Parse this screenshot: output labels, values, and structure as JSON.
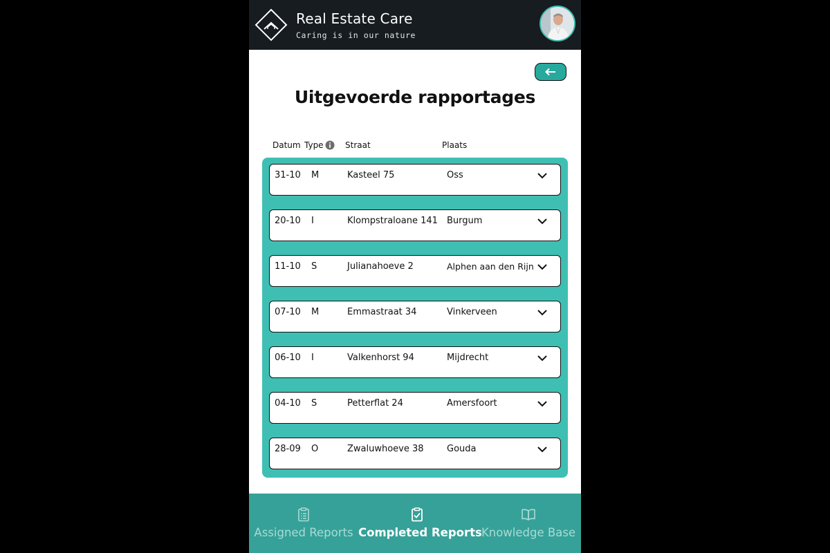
{
  "header": {
    "title": "Real Estate Care",
    "subtitle": "Caring is in our nature",
    "logo_icon": "diamond-house-icon",
    "avatar_icon": "user-avatar"
  },
  "toolbar": {
    "back_icon": "arrow-left-icon"
  },
  "page": {
    "title": "Uitgevoerde rapportages"
  },
  "table": {
    "columns": [
      "Datum",
      "Type",
      "Straat",
      "Plaats"
    ],
    "type_info_icon": "info-icon",
    "rows": [
      {
        "date": "31-10",
        "type": "M",
        "street": "Kasteel 75",
        "city": "Oss"
      },
      {
        "date": "20-10",
        "type": "I",
        "street": "Klompstraloane 141",
        "city": "Burgum"
      },
      {
        "date": "11-10",
        "type": "S",
        "street": "Julianahoeve 2",
        "city": "Alphen aan den Rijn"
      },
      {
        "date": "07-10",
        "type": "M",
        "street": "Emmastraat 34",
        "city": "Vinkerveen"
      },
      {
        "date": "06-10",
        "type": "I",
        "street": "Valkenhorst 94",
        "city": "Mijdrecht"
      },
      {
        "date": "04-10",
        "type": "S",
        "street": "Petterflat 24",
        "city": "Amersfoort"
      },
      {
        "date": "28-09",
        "type": "O",
        "street": "Zwaluwhoeve 38",
        "city": "Gouda"
      }
    ]
  },
  "tabbar": {
    "tabs": [
      {
        "label": "Assigned Reports",
        "icon": "clipboard-list-icon",
        "active": false
      },
      {
        "label": "Completed Reports",
        "icon": "clipboard-check-icon",
        "active": true
      },
      {
        "label": "Knowledge Base",
        "icon": "book-open-icon",
        "active": false
      }
    ]
  },
  "colors": {
    "header_bg": "#161c1f",
    "accent": "#3fbfb4",
    "button": "#27a99e",
    "tabbar_bg": "#36a198"
  }
}
